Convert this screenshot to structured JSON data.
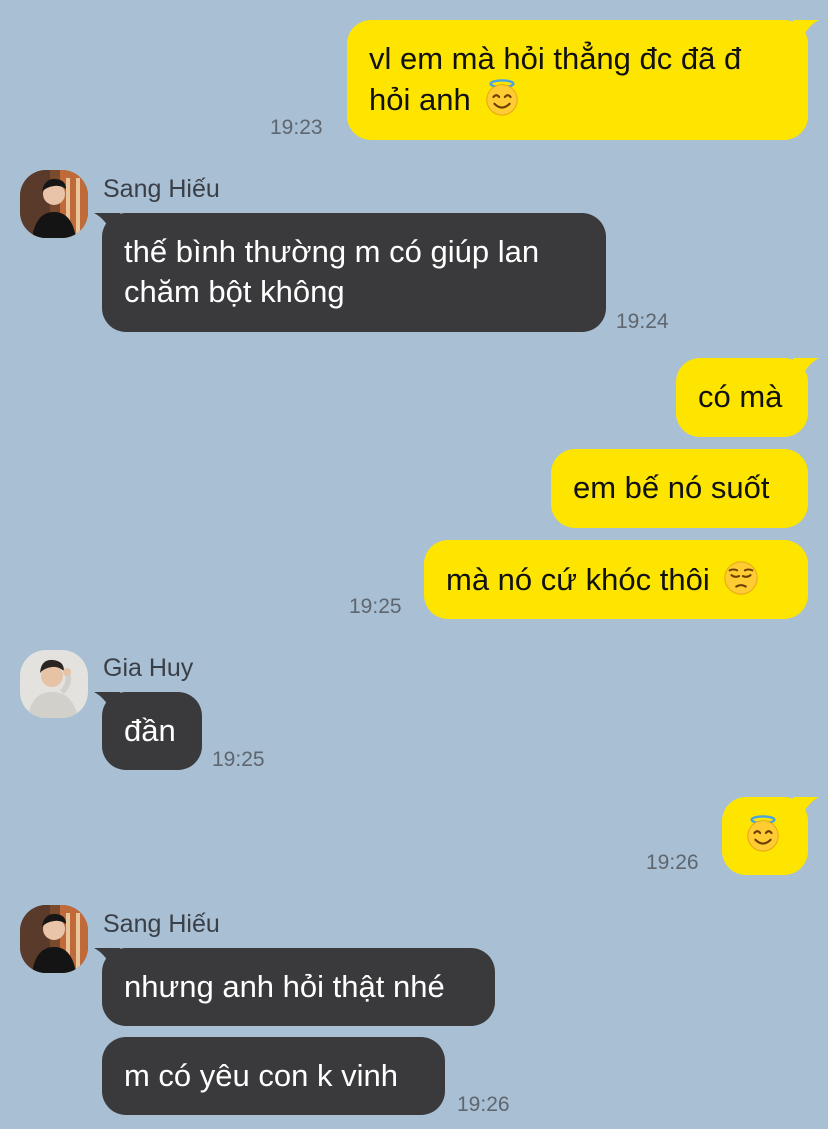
{
  "messages": [
    {
      "id": "m1",
      "direction": "outgoing",
      "lines": [
        "vl em mà hỏi thẳng đc đã đ",
        "hỏi anh"
      ],
      "emoji": "smiling-face-with-halo",
      "time": "19:23"
    },
    {
      "id": "m2",
      "direction": "incoming",
      "sender": "Sang Hiếu",
      "lines": [
        "thế bình thường m có giúp lan",
        "chăm bột không"
      ],
      "time": "19:24"
    },
    {
      "id": "m3",
      "direction": "outgoing",
      "lines": [
        "có mà"
      ]
    },
    {
      "id": "m4",
      "direction": "outgoing",
      "lines": [
        "em bế nó suốt"
      ]
    },
    {
      "id": "m5",
      "direction": "outgoing",
      "lines": [
        "mà nó cứ khóc thôi"
      ],
      "emoji": "pensive-face",
      "time": "19:25"
    },
    {
      "id": "m6",
      "direction": "incoming",
      "sender": "Gia Huy",
      "lines": [
        "đần"
      ],
      "time": "19:25"
    },
    {
      "id": "m7",
      "direction": "outgoing",
      "lines": [],
      "emoji": "smiling-face-with-halo",
      "time": "19:26"
    },
    {
      "id": "m8",
      "direction": "incoming",
      "sender": "Sang Hiếu",
      "lines": [
        "nhưng anh hỏi thật nhé"
      ]
    },
    {
      "id": "m9",
      "direction": "incoming",
      "lines": [
        "m có yêu con k vinh"
      ],
      "time": "19:26"
    }
  ],
  "colors": {
    "background": "#a9bfd3",
    "outgoing_bubble": "#fde500",
    "incoming_bubble": "#3a3a3c",
    "timestamp": "#5e6670"
  }
}
